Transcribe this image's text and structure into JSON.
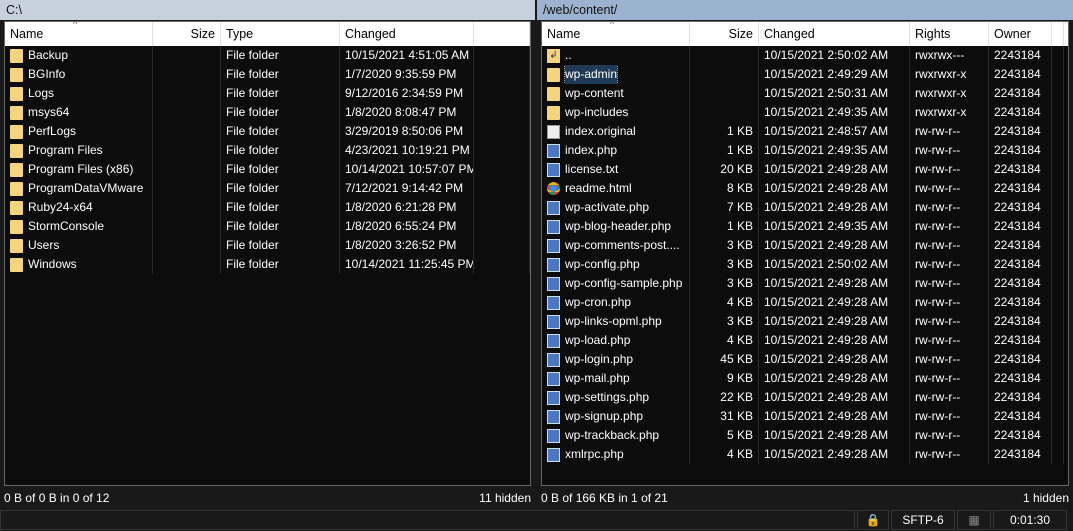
{
  "left": {
    "path": "C:\\",
    "columns": [
      "Name",
      "Size",
      "Type",
      "Changed"
    ],
    "rows": [
      [
        "Backup",
        "",
        "File folder",
        "10/15/2021  4:51:05 AM"
      ],
      [
        "BGInfo",
        "",
        "File folder",
        "1/7/2020  9:35:59 PM"
      ],
      [
        "Logs",
        "",
        "File folder",
        "9/12/2016  2:34:59 PM"
      ],
      [
        "msys64",
        "",
        "File folder",
        "1/8/2020  8:08:47 PM"
      ],
      [
        "PerfLogs",
        "",
        "File folder",
        "3/29/2019  8:50:06 PM"
      ],
      [
        "Program Files",
        "",
        "File folder",
        "4/23/2021  10:19:21 PM"
      ],
      [
        "Program Files (x86)",
        "",
        "File folder",
        "10/14/2021  10:57:07 PM"
      ],
      [
        "ProgramDataVMware",
        "",
        "File folder",
        "7/12/2021  9:14:42 PM"
      ],
      [
        "Ruby24-x64",
        "",
        "File folder",
        "1/8/2020  6:21:28 PM"
      ],
      [
        "StormConsole",
        "",
        "File folder",
        "1/8/2020  6:55:24 PM"
      ],
      [
        "Users",
        "",
        "File folder",
        "1/8/2020  3:26:52 PM"
      ],
      [
        "Windows",
        "",
        "File folder",
        "10/14/2021  11:25:45 PM"
      ]
    ],
    "status": "0 B of 0 B in 0 of 12",
    "hidden": "11 hidden"
  },
  "right": {
    "path": "/web/content/",
    "columns": [
      "Name",
      "Size",
      "Changed",
      "Rights",
      "Owner"
    ],
    "rows": [
      {
        "icon": "up",
        "c": [
          "..",
          "",
          "10/15/2021 2:50:02 AM",
          "rwxrwx---",
          "2243184"
        ]
      },
      {
        "icon": "folder",
        "c": [
          "wp-admin",
          "",
          "10/15/2021 2:49:29 AM",
          "rwxrwxr-x",
          "2243184"
        ],
        "sel": true
      },
      {
        "icon": "folder",
        "c": [
          "wp-content",
          "",
          "10/15/2021 2:50:31 AM",
          "rwxrwxr-x",
          "2243184"
        ]
      },
      {
        "icon": "folder",
        "c": [
          "wp-includes",
          "",
          "10/15/2021 2:49:35 AM",
          "rwxrwxr-x",
          "2243184"
        ]
      },
      {
        "icon": "file",
        "c": [
          "index.original",
          "1 KB",
          "10/15/2021 2:48:57 AM",
          "rw-rw-r--",
          "2243184"
        ]
      },
      {
        "icon": "php",
        "c": [
          "index.php",
          "1 KB",
          "10/15/2021 2:49:35 AM",
          "rw-rw-r--",
          "2243184"
        ]
      },
      {
        "icon": "php",
        "c": [
          "license.txt",
          "20 KB",
          "10/15/2021 2:49:28 AM",
          "rw-rw-r--",
          "2243184"
        ]
      },
      {
        "icon": "chrome",
        "c": [
          "readme.html",
          "8 KB",
          "10/15/2021 2:49:28 AM",
          "rw-rw-r--",
          "2243184"
        ]
      },
      {
        "icon": "php",
        "c": [
          "wp-activate.php",
          "7 KB",
          "10/15/2021 2:49:28 AM",
          "rw-rw-r--",
          "2243184"
        ]
      },
      {
        "icon": "php",
        "c": [
          "wp-blog-header.php",
          "1 KB",
          "10/15/2021 2:49:35 AM",
          "rw-rw-r--",
          "2243184"
        ]
      },
      {
        "icon": "php",
        "c": [
          "wp-comments-post....",
          "3 KB",
          "10/15/2021 2:49:28 AM",
          "rw-rw-r--",
          "2243184"
        ]
      },
      {
        "icon": "php",
        "c": [
          "wp-config.php",
          "3 KB",
          "10/15/2021 2:50:02 AM",
          "rw-rw-r--",
          "2243184"
        ]
      },
      {
        "icon": "php",
        "c": [
          "wp-config-sample.php",
          "3 KB",
          "10/15/2021 2:49:28 AM",
          "rw-rw-r--",
          "2243184"
        ]
      },
      {
        "icon": "php",
        "c": [
          "wp-cron.php",
          "4 KB",
          "10/15/2021 2:49:28 AM",
          "rw-rw-r--",
          "2243184"
        ]
      },
      {
        "icon": "php",
        "c": [
          "wp-links-opml.php",
          "3 KB",
          "10/15/2021 2:49:28 AM",
          "rw-rw-r--",
          "2243184"
        ]
      },
      {
        "icon": "php",
        "c": [
          "wp-load.php",
          "4 KB",
          "10/15/2021 2:49:28 AM",
          "rw-rw-r--",
          "2243184"
        ]
      },
      {
        "icon": "php",
        "c": [
          "wp-login.php",
          "45 KB",
          "10/15/2021 2:49:28 AM",
          "rw-rw-r--",
          "2243184"
        ]
      },
      {
        "icon": "php",
        "c": [
          "wp-mail.php",
          "9 KB",
          "10/15/2021 2:49:28 AM",
          "rw-rw-r--",
          "2243184"
        ]
      },
      {
        "icon": "php",
        "c": [
          "wp-settings.php",
          "22 KB",
          "10/15/2021 2:49:28 AM",
          "rw-rw-r--",
          "2243184"
        ]
      },
      {
        "icon": "php",
        "c": [
          "wp-signup.php",
          "31 KB",
          "10/15/2021 2:49:28 AM",
          "rw-rw-r--",
          "2243184"
        ]
      },
      {
        "icon": "php",
        "c": [
          "wp-trackback.php",
          "5 KB",
          "10/15/2021 2:49:28 AM",
          "rw-rw-r--",
          "2243184"
        ]
      },
      {
        "icon": "php",
        "c": [
          "xmlrpc.php",
          "4 KB",
          "10/15/2021 2:49:28 AM",
          "rw-rw-r--",
          "2243184"
        ]
      }
    ],
    "status": "0 B of 166 KB in 1 of 21",
    "hidden": "1 hidden"
  },
  "bottom": {
    "protocol": "SFTP-6",
    "elapsed": "0:01:30"
  }
}
